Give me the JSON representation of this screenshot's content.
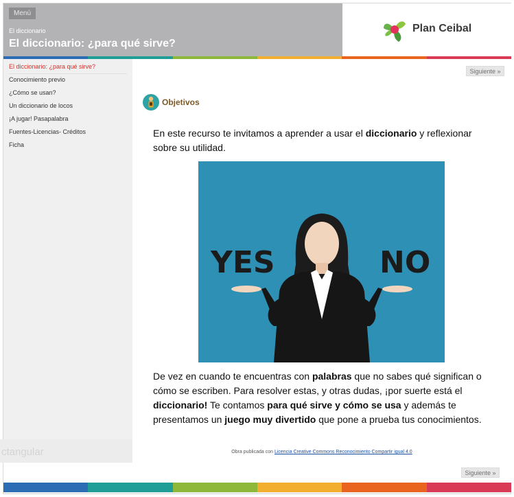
{
  "header": {
    "menu_label": "Menú",
    "breadcrumb": "El diccionario",
    "title": "El diccionario: ¿para qué sirve?",
    "logo_text": "Plan Ceibal"
  },
  "nav": {
    "items": [
      {
        "label": "El diccionario: ¿para qué sirve?"
      },
      {
        "label": "Conocimiento previo"
      },
      {
        "label": "¿Cómo se usan?"
      },
      {
        "label": "Un diccionario de locos"
      },
      {
        "label": "¡A jugar! Pasapalabra"
      },
      {
        "label": "Fuentes-Licencias- Créditos"
      },
      {
        "label": "Ficha"
      }
    ],
    "ghost_text": "ctangular"
  },
  "buttons": {
    "next_top": "Siguiente »",
    "next_bottom": "Siguiente »"
  },
  "section": {
    "title": "Objetivos"
  },
  "content": {
    "p1_a": "En este recurso te invitamos a aprender a usar el ",
    "p1_b": "diccionario",
    "p1_c": " y reflexionar sobre su utilidad.",
    "image_text_yes": "YES",
    "image_text_no": "NO",
    "p2_a": "De vez en cuando te encuentras con ",
    "p2_b": "palabras",
    "p2_c": " que no sabes qué significan o cómo se escriben. Para resolver estas, y otras dudas, ¡por suerte está el ",
    "p2_d": "diccionario!",
    "p2_e": " Te contamos ",
    "p2_f": "para qué sirve y cómo se usa",
    "p2_g": " y además te presentamos un ",
    "p2_h": "juego muy divertido",
    "p2_i": " que pone a prueba tus conocimientos."
  },
  "footer": {
    "license_prefix": "Obra publicada con ",
    "license_link": "Licencia Creative Commons Reconocimiento Compartir igual 4.0"
  },
  "colors": {
    "header_gray": "#b3b3b6",
    "active_nav": "#d4302a",
    "stripe": [
      "#2b6cb4",
      "#1f9e97",
      "#8db83a",
      "#f2ae2e",
      "#e9641f",
      "#d93a55"
    ]
  }
}
